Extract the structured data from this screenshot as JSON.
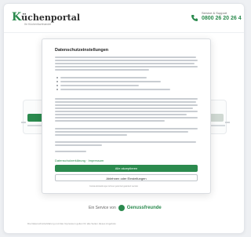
{
  "header": {
    "logo_prefix": "K",
    "logo_text": "üchenportal",
    "logo_subtitle": "Ihr Küchenfachhandel",
    "phone_label": "Service & Support",
    "phone_number": "0800 26 20 26 4",
    "phone_icon": "phone-icon"
  },
  "modal": {
    "title": "Datenschutzeinstellungen",
    "link_text": "Datenschutzerklärung · Impressum",
    "accept_label": "Alle akzeptieren",
    "settings_label": "Ablehnen oder Einstellungen",
    "footer_text": "Cookie-Einstellungen können jederzeit geändert werden"
  },
  "footer": {
    "brand_prefix": "Ein Service von",
    "brand_name": "Genussfreunde",
    "links": "Die Datenschutzerklärung und das Impressum gelten für alle Seiten dieses Angebots"
  },
  "colors": {
    "accent": "#2b8a4e"
  }
}
